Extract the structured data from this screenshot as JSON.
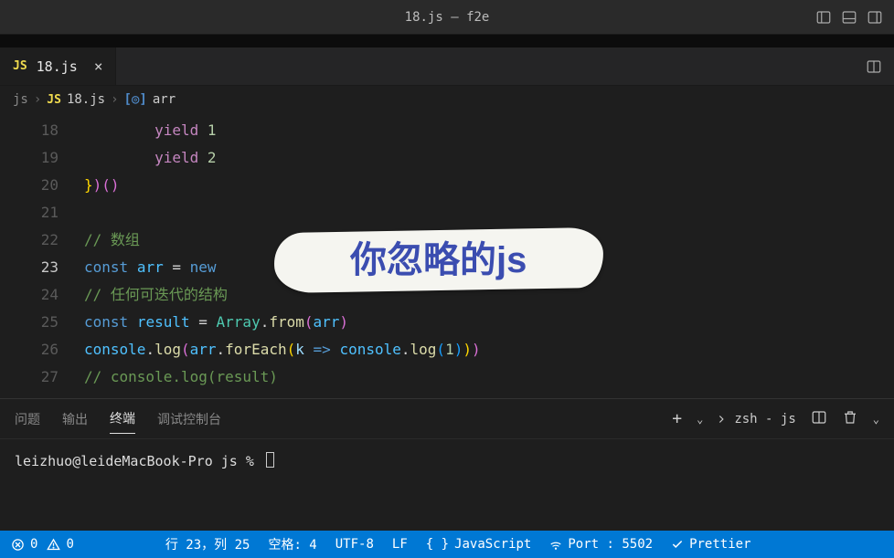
{
  "titlebar": {
    "title": "18.js — f2e"
  },
  "tab": {
    "badge": "JS",
    "name": "18.js"
  },
  "breadcrumb": {
    "seg1": "js",
    "seg2_badge": "JS",
    "seg2": "18.js",
    "seg3_icon": "[◎]",
    "seg3": "arr"
  },
  "code": {
    "lines": [
      {
        "n": 18,
        "tokens": [
          [
            "",
            "        "
          ],
          [
            "kw",
            "yield"
          ],
          [
            "",
            " "
          ],
          [
            "num",
            "1"
          ]
        ]
      },
      {
        "n": 19,
        "tokens": [
          [
            "",
            "        "
          ],
          [
            "kw",
            "yield"
          ],
          [
            "",
            " "
          ],
          [
            "num",
            "2"
          ]
        ]
      },
      {
        "n": 20,
        "tokens": [
          [
            "paren2",
            "}"
          ],
          [
            "paren",
            ")"
          ],
          [
            "paren",
            "("
          ],
          [
            "paren",
            ")"
          ]
        ]
      },
      {
        "n": 21,
        "tokens": []
      },
      {
        "n": 22,
        "tokens": [
          [
            "cmt",
            "// 数组"
          ]
        ]
      },
      {
        "n": 23,
        "active": true,
        "tokens": [
          [
            "decl",
            "const"
          ],
          [
            "",
            " "
          ],
          [
            "var",
            "arr"
          ],
          [
            "",
            " "
          ],
          [
            "pun",
            "="
          ],
          [
            "",
            " "
          ],
          [
            "decl",
            "new"
          ]
        ]
      },
      {
        "n": 24,
        "tokens": [
          [
            "cmt",
            "// 任何可迭代的结构"
          ]
        ]
      },
      {
        "n": 25,
        "tokens": [
          [
            "decl",
            "const"
          ],
          [
            "",
            " "
          ],
          [
            "var",
            "result"
          ],
          [
            "",
            " "
          ],
          [
            "pun",
            "="
          ],
          [
            "",
            " "
          ],
          [
            "cls",
            "Array"
          ],
          [
            "pun",
            "."
          ],
          [
            "func",
            "from"
          ],
          [
            "paren",
            "("
          ],
          [
            "var",
            "arr"
          ],
          [
            "paren",
            ")"
          ]
        ]
      },
      {
        "n": 26,
        "tokens": [
          [
            "var",
            "console"
          ],
          [
            "pun",
            "."
          ],
          [
            "func",
            "log"
          ],
          [
            "paren",
            "("
          ],
          [
            "var",
            "arr"
          ],
          [
            "pun",
            "."
          ],
          [
            "func",
            "forEach"
          ],
          [
            "paren2",
            "("
          ],
          [
            "prm",
            "k"
          ],
          [
            "",
            " "
          ],
          [
            "decl",
            "=>"
          ],
          [
            "",
            " "
          ],
          [
            "var",
            "console"
          ],
          [
            "pun",
            "."
          ],
          [
            "func",
            "log"
          ],
          [
            "paren3",
            "("
          ],
          [
            "num",
            "1"
          ],
          [
            "paren3",
            ")"
          ],
          [
            "paren2",
            ")"
          ],
          [
            "paren",
            ")"
          ]
        ]
      },
      {
        "n": 27,
        "tokens": [
          [
            "cmt",
            "// console.log(result)"
          ]
        ]
      }
    ]
  },
  "overlay": {
    "text": "你忽略的js"
  },
  "panel": {
    "tabs": [
      "问题",
      "输出",
      "终端",
      "调试控制台"
    ],
    "active": 2,
    "shell": "zsh - js",
    "prompt": "leizhuo@leideMacBook-Pro js % "
  },
  "statusbar": {
    "errors": "0",
    "warnings": "0",
    "pos": "行 23，列 25",
    "indent": "空格: 4",
    "encoding": "UTF-8",
    "eol": "LF",
    "lang": "JavaScript",
    "port": "Port : 5502",
    "prettier": "Prettier"
  }
}
